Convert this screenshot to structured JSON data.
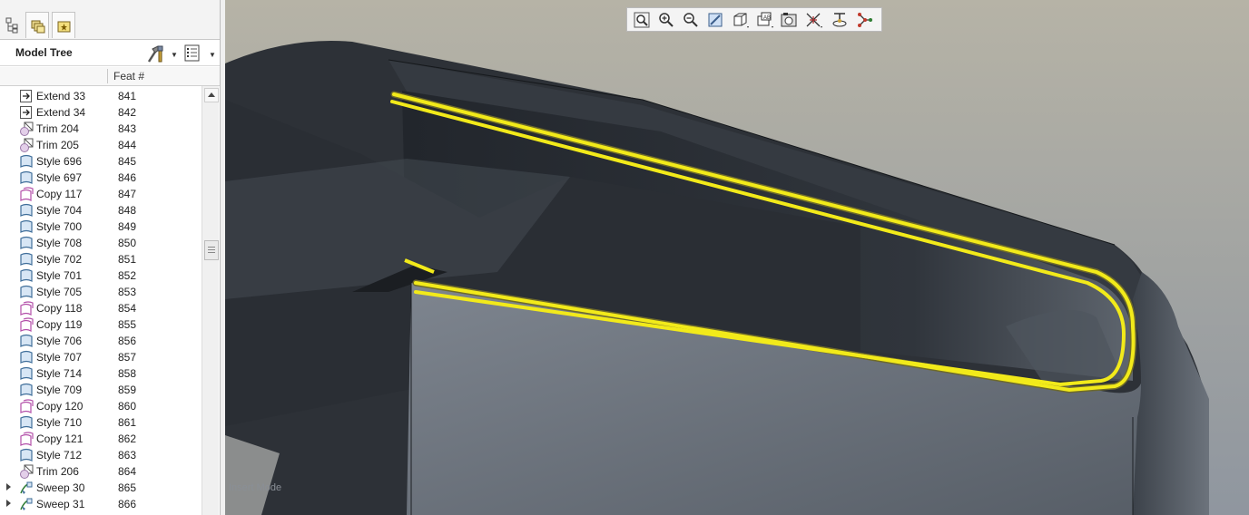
{
  "model_tree": {
    "title": "Model Tree",
    "column_header": "Feat #",
    "rows": [
      {
        "name": "Extend 33",
        "feat": "841",
        "icon": "extend-icon"
      },
      {
        "name": "Extend 34",
        "feat": "842",
        "icon": "extend-icon"
      },
      {
        "name": "Trim 204",
        "feat": "843",
        "icon": "trim-icon"
      },
      {
        "name": "Trim 205",
        "feat": "844",
        "icon": "trim-icon"
      },
      {
        "name": "Style 696",
        "feat": "845",
        "icon": "style-icon"
      },
      {
        "name": "Style 697",
        "feat": "846",
        "icon": "style-icon"
      },
      {
        "name": "Copy 117",
        "feat": "847",
        "icon": "copy-icon"
      },
      {
        "name": "Style 704",
        "feat": "848",
        "icon": "style-icon"
      },
      {
        "name": "Style 700",
        "feat": "849",
        "icon": "style-icon"
      },
      {
        "name": "Style 708",
        "feat": "850",
        "icon": "style-icon"
      },
      {
        "name": "Style 702",
        "feat": "851",
        "icon": "style-icon"
      },
      {
        "name": "Style 701",
        "feat": "852",
        "icon": "style-icon"
      },
      {
        "name": "Style 705",
        "feat": "853",
        "icon": "style-icon"
      },
      {
        "name": "Copy 118",
        "feat": "854",
        "icon": "copy-icon"
      },
      {
        "name": "Copy 119",
        "feat": "855",
        "icon": "copy-icon"
      },
      {
        "name": "Style 706",
        "feat": "856",
        "icon": "style-icon"
      },
      {
        "name": "Style 707",
        "feat": "857",
        "icon": "style-icon"
      },
      {
        "name": "Style 714",
        "feat": "858",
        "icon": "style-icon"
      },
      {
        "name": "Style 709",
        "feat": "859",
        "icon": "style-icon"
      },
      {
        "name": "Copy 120",
        "feat": "860",
        "icon": "copy-icon"
      },
      {
        "name": "Style 710",
        "feat": "861",
        "icon": "style-icon"
      },
      {
        "name": "Copy 121",
        "feat": "862",
        "icon": "copy-icon"
      },
      {
        "name": "Style 712",
        "feat": "863",
        "icon": "style-icon"
      },
      {
        "name": "Trim 206",
        "feat": "864",
        "icon": "trim-icon"
      },
      {
        "name": "Sweep 30",
        "feat": "865",
        "icon": "sweep-icon",
        "expandable": true
      },
      {
        "name": "Sweep 31",
        "feat": "866",
        "icon": "sweep-icon",
        "expandable": true
      }
    ]
  },
  "panel_tabs": [
    "model-tree-tab-icon",
    "folder-browser-tab-icon",
    "favorites-tab-icon"
  ],
  "view_toolbar": [
    "refit-icon",
    "zoom-in-icon",
    "zoom-out-icon",
    "repaint-icon",
    "display-style-icon",
    "saved-views-icon",
    "view-manager-icon",
    "datum-display-icon",
    "spin-center-icon",
    "annotation-display-icon"
  ],
  "status": {
    "insert_mode": "Insert Mode"
  },
  "colors": {
    "highlight_edge": "#f2ea1a",
    "model_surface": "#2b2f35",
    "background_top": "#b0ad9f"
  }
}
